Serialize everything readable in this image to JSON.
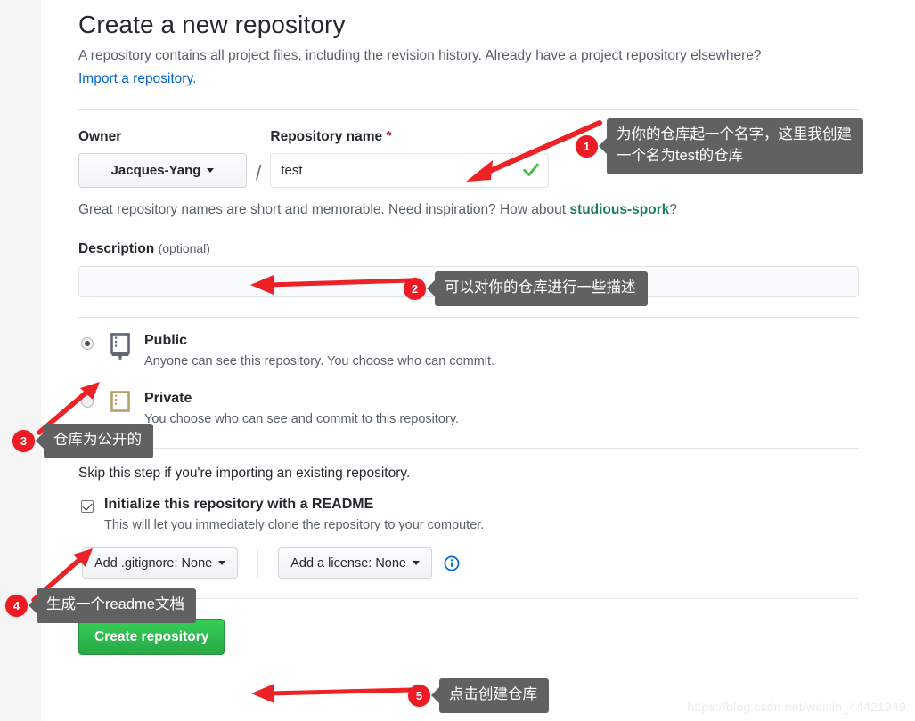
{
  "page": {
    "title": "Create a new repository",
    "lede_text": "A repository contains all project files, including the revision history. Already have a project repository elsewhere?",
    "lede_link": "Import a repository."
  },
  "owner": {
    "label": "Owner",
    "selected": "Jacques-Yang",
    "separator": "/"
  },
  "repo_name": {
    "label": "Repository name",
    "required_mark": "*",
    "value": "test",
    "valid_icon": "green-check-icon",
    "helper_prefix": "Great repository names are short and memorable. Need inspiration? How about ",
    "helper_suggestion": "studious-spork",
    "helper_suffix": "?"
  },
  "description": {
    "label": "Description",
    "optional_note": "(optional)",
    "value": "",
    "placeholder": ""
  },
  "visibility": {
    "options": [
      {
        "id": "public",
        "title": "Public",
        "subtitle": "Anyone can see this repository. You choose who can commit.",
        "selected": true,
        "icon": "repo-book-icon"
      },
      {
        "id": "private",
        "title": "Private",
        "subtitle": "You choose who can see and commit to this repository.",
        "selected": false,
        "icon": "repo-lock-icon"
      }
    ]
  },
  "initialize": {
    "skip_note": "Skip this step if you're importing an existing repository.",
    "checkbox_label": "Initialize this repository with a README",
    "checkbox_sub": "This will let you immediately clone the repository to your computer.",
    "checked": true,
    "gitignore_button": "Add .gitignore: None",
    "license_button": "Add a license: None",
    "info_icon": "info-circle-icon"
  },
  "submit": {
    "label": "Create repository"
  },
  "annotations": [
    {
      "number": "1",
      "text": "为你的仓库起一个名字，这里我创建\n一个名为test的仓库"
    },
    {
      "number": "2",
      "text": "可以对你的仓库进行一些描述"
    },
    {
      "number": "3",
      "text": "仓库为公开的"
    },
    {
      "number": "4",
      "text": "生成一个readme文档"
    },
    {
      "number": "5",
      "text": "点击创建仓库"
    }
  ],
  "watermark": "https://blog.csdn.net/weixin_44421949",
  "colors": {
    "accent_link": "#0366d6",
    "annotation_red": "#ed1c24",
    "callout_gray": "#616161",
    "submit_green": "#28a745",
    "suggestion_green": "#1b7e5a"
  }
}
